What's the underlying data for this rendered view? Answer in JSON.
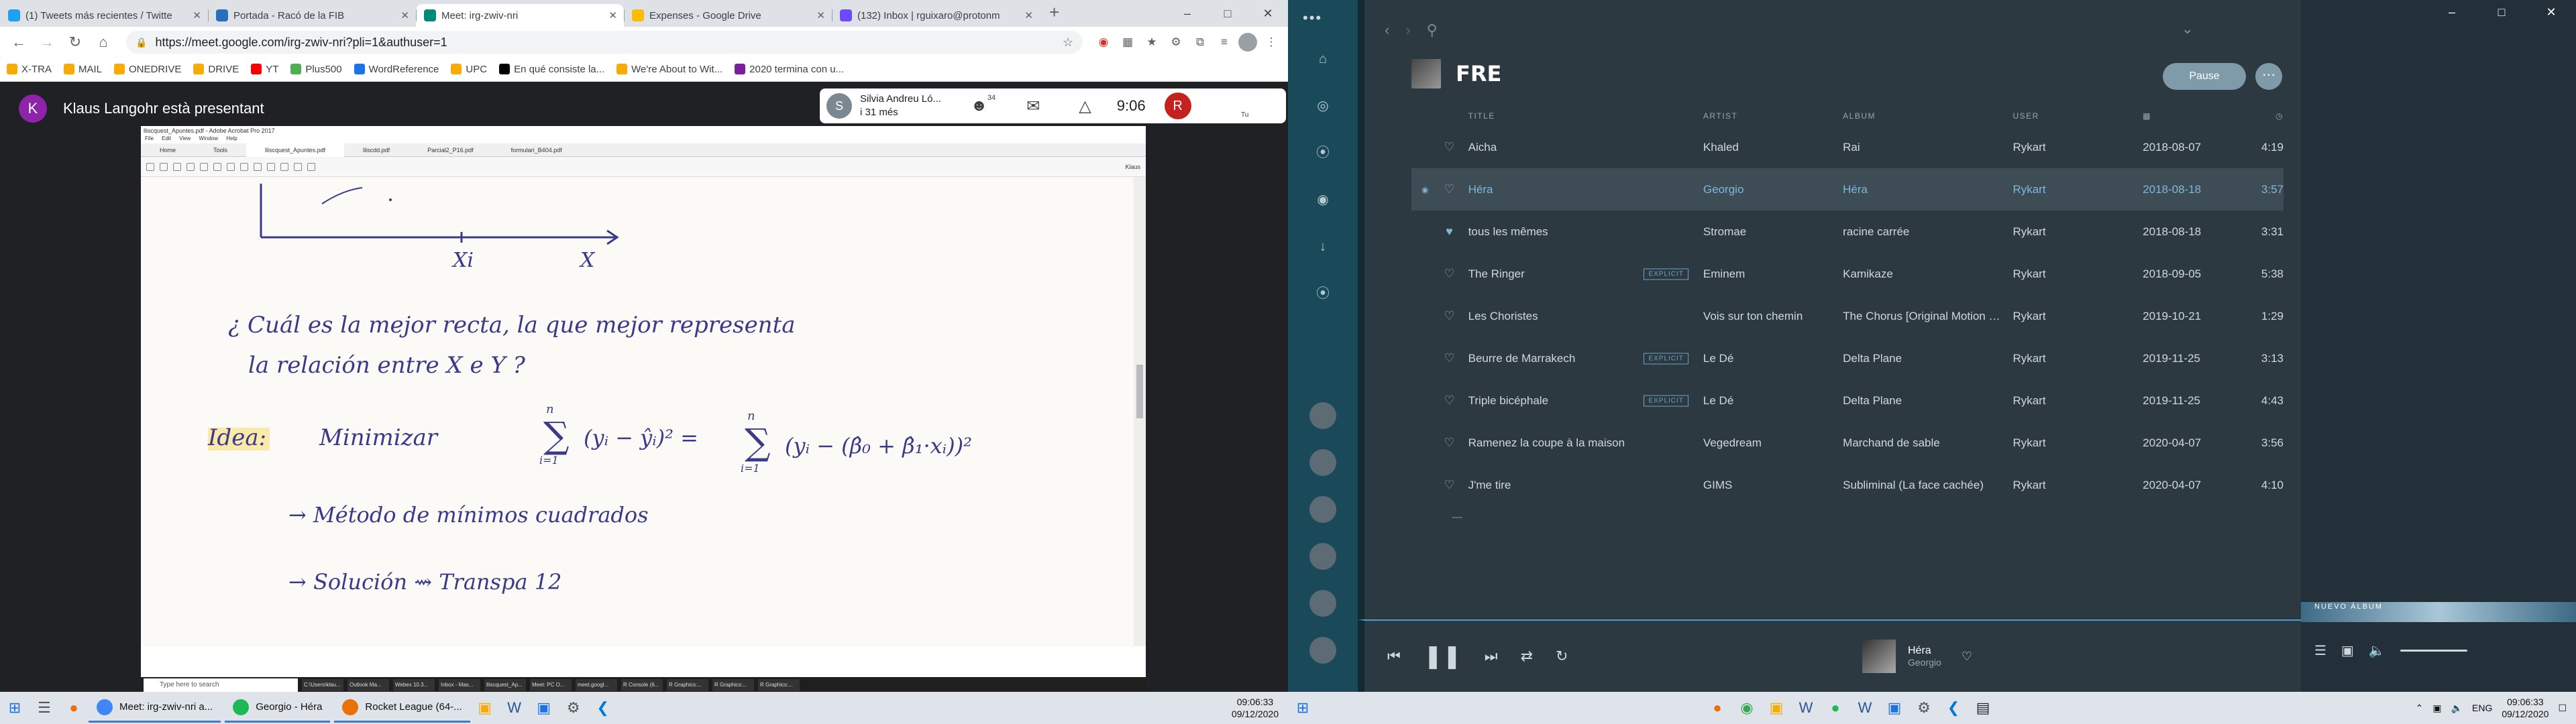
{
  "browser": {
    "tabs": [
      {
        "label": "(1) Tweets más recientes / Twitte",
        "fav": "t",
        "color": "#1da1f2",
        "active": false
      },
      {
        "label": "Portada - Racó de la FIB",
        "fav": "r",
        "color": "#2a6ebb",
        "active": false
      },
      {
        "label": "Meet: irg-zwiv-nri",
        "fav": "m",
        "color": "#00897b",
        "active": true
      },
      {
        "label": "Expenses - Google Drive",
        "fav": "d",
        "color": "#fbbc04",
        "active": false
      },
      {
        "label": "(132) Inbox | rguixaro@protonm",
        "fav": "p",
        "color": "#6d4aff",
        "active": false
      }
    ],
    "new_tab": "+",
    "url": "https://meet.google.com/irg-zwiv-nri?pli=1&authuser=1",
    "bookmarks": [
      "X-TRA",
      "MAIL",
      "ONEDRIVE",
      "DRIVE",
      "YT",
      "Plus500",
      "WordReference",
      "UPC",
      "En qué consiste la...",
      "We're About to Wit...",
      "2020 termina con u..."
    ]
  },
  "meet": {
    "presenter_initial": "K",
    "presenter_text": "Klaus Langohr està presentant",
    "speaker_initial": "S",
    "speaker_name": "Silvia Andreu Ló...",
    "speaker_sub": "i 31 més",
    "participants_count": "34",
    "clock": "9:06",
    "self_initial": "R",
    "self_label": "Tu"
  },
  "pdf": {
    "title": "lliscquest_Apuntes.pdf - Adobe Acrobat Pro 2017",
    "menu": "File Edit View Window Help",
    "tabs": [
      "Home",
      "Tools",
      "lliscquest_Apuntes.pdf",
      "lliscdd.pdf",
      "Parcial2_P16.pdf",
      "formulari_B404.pdf"
    ],
    "user": "Klaus",
    "xi_label": "Xi",
    "x_label": "X",
    "question_line1": "¿ Cuál es la mejor recta, la que mejor representa",
    "question_line2": "la relación entre X e Y ?",
    "idea_label": "Idea:",
    "idea_text": "Minimizar",
    "method_line": "→ Método de mínimos cuadrados",
    "solution_line": "→ Solución ⇝ Transpa 12",
    "search_placeholder": "Type here to search",
    "taskbar_apps": [
      "C:\\Users\\klau...",
      "Outlook Ma...",
      "Webex 10.3...",
      "Inbox - Mas...",
      "lliscquest_Ap...",
      "Meet: PC O...",
      "meet.googl...",
      "R Console (6...",
      "R Graphics:...",
      "R Graphics:...",
      "R Graphics:..."
    ]
  },
  "taskbar_left": {
    "apps": [
      {
        "label": "Meet: irg-zwiv-nri a...",
        "color": "#4285f4"
      },
      {
        "label": "Georgio - Héra",
        "color": "#1db954"
      },
      {
        "label": "Rocket League (64-...",
        "color": "#e8710a"
      }
    ],
    "time": "09:06:33",
    "date": "09/12/2020"
  },
  "deezer": {
    "playlist_name": "FRE",
    "pause_label": "Pause",
    "columns": {
      "title": "TITLE",
      "artist": "ARTIST",
      "album": "ALBUM",
      "user": "USER"
    },
    "tracks": [
      {
        "title": "Aicha",
        "explicit": false,
        "artist": "Khaled",
        "album": "Rai",
        "user": "Rykart",
        "date": "2018-08-07",
        "duration": "4:19",
        "liked": false,
        "active": false
      },
      {
        "title": "Héra",
        "explicit": false,
        "artist": "Georgio",
        "album": "Héra",
        "user": "Rykart",
        "date": "2018-08-18",
        "duration": "3:57",
        "liked": false,
        "active": true
      },
      {
        "title": "tous les mêmes",
        "explicit": false,
        "artist": "Stromae",
        "album": "racine carrée",
        "user": "Rykart",
        "date": "2018-08-18",
        "duration": "3:31",
        "liked": true,
        "active": false
      },
      {
        "title": "The Ringer",
        "explicit": true,
        "artist": "Eminem",
        "album": "Kamikaze",
        "user": "Rykart",
        "date": "2018-09-05",
        "duration": "5:38",
        "liked": false,
        "active": false
      },
      {
        "title": "Les Choristes",
        "explicit": false,
        "artist": "Vois sur ton chemin",
        "album": "The Chorus [Original Motion Picture Soundtrack]",
        "user": "Rykart",
        "date": "2019-10-21",
        "duration": "1:29",
        "liked": false,
        "active": false
      },
      {
        "title": "Beurre de Marrakech",
        "explicit": true,
        "artist": "Le Dé",
        "album": "Delta Plane",
        "user": "Rykart",
        "date": "2019-11-25",
        "duration": "3:13",
        "liked": false,
        "active": false
      },
      {
        "title": "Triple bicéphale",
        "explicit": true,
        "artist": "Le Dé",
        "album": "Delta Plane",
        "user": "Rykart",
        "date": "2019-11-25",
        "duration": "4:43",
        "liked": false,
        "active": false
      },
      {
        "title": "Ramenez la coupe à la maison",
        "explicit": false,
        "artist": "Vegedream",
        "album": "Marchand de sable",
        "user": "Rykart",
        "date": "2020-04-07",
        "duration": "3:56",
        "liked": false,
        "active": false
      },
      {
        "title": "J'me tire",
        "explicit": false,
        "artist": "GIMS",
        "album": "Subliminal (La face cachée)",
        "user": "Rykart",
        "date": "2020-04-07",
        "duration": "4:10",
        "liked": false,
        "active": false
      }
    ],
    "explicit_label": "EXPLICIT",
    "now_playing": {
      "title": "Héra",
      "artist": "Georgio"
    },
    "banner": "NUEVO ÁLBUM"
  },
  "taskbar_right": {
    "lang": "ENG",
    "time": "09:06:33",
    "date": "09/12/2020"
  },
  "colors": {
    "accent": "#4a9fcf",
    "deezer_bg": "#2d3941",
    "meet_bg": "#202124"
  }
}
